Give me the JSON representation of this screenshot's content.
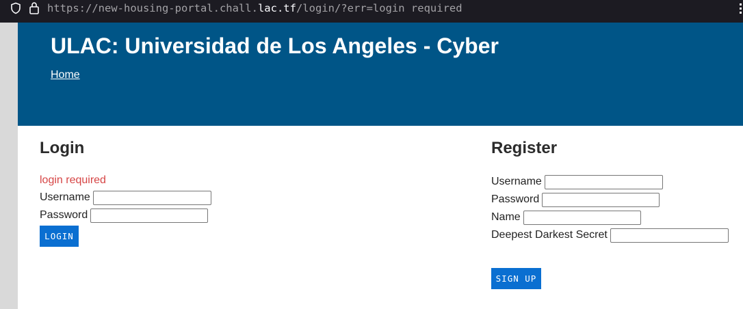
{
  "browser": {
    "url_prefix": "https://new-housing-portal.chall.",
    "url_domain": "lac.tf",
    "url_suffix": "/login/?err=login required"
  },
  "header": {
    "title": "ULAC: Universidad de Los Angeles - Cyber",
    "home_link": "Home",
    "bg_color": "#005587"
  },
  "login": {
    "heading": "Login",
    "error": "login required",
    "username_label": "Username",
    "password_label": "Password",
    "button_label": "LOGIN"
  },
  "register": {
    "heading": "Register",
    "username_label": "Username",
    "password_label": "Password",
    "name_label": "Name",
    "secret_label": "Deepest Darkest Secret",
    "button_label": "SIGN UP"
  },
  "colors": {
    "accent": "#0a6fd1",
    "error": "#d64545"
  }
}
